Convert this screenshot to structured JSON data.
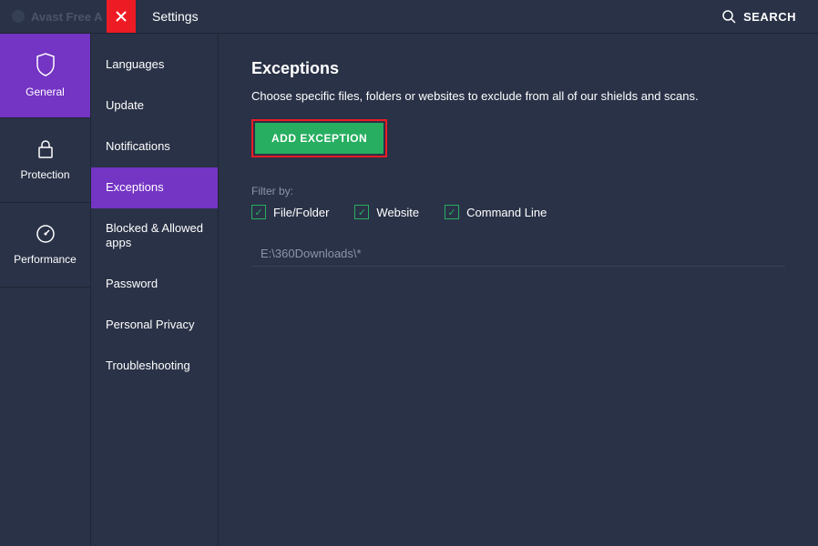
{
  "app_title": "Avast Free A",
  "header": {
    "settings_label": "Settings",
    "search_label": "SEARCH"
  },
  "sidebar_primary": [
    {
      "id": "general",
      "label": "General",
      "icon": "shield",
      "active": true
    },
    {
      "id": "protection",
      "label": "Protection",
      "icon": "lock",
      "active": false
    },
    {
      "id": "performance",
      "label": "Performance",
      "icon": "gauge",
      "active": false
    }
  ],
  "sidebar_secondary": [
    {
      "id": "languages",
      "label": "Languages",
      "active": false
    },
    {
      "id": "update",
      "label": "Update",
      "active": false
    },
    {
      "id": "notifications",
      "label": "Notifications",
      "active": false
    },
    {
      "id": "exceptions",
      "label": "Exceptions",
      "active": true
    },
    {
      "id": "blocked",
      "label": "Blocked & Allowed apps",
      "active": false
    },
    {
      "id": "password",
      "label": "Password",
      "active": false
    },
    {
      "id": "privacy",
      "label": "Personal Privacy",
      "active": false
    },
    {
      "id": "troubleshooting",
      "label": "Troubleshooting",
      "active": false
    }
  ],
  "content": {
    "title": "Exceptions",
    "description": "Choose specific files, folders or websites to exclude from all of our shields and scans.",
    "add_button": "ADD EXCEPTION",
    "filter_label": "Filter by:",
    "filters": [
      {
        "id": "file-folder",
        "label": "File/Folder",
        "checked": true
      },
      {
        "id": "website",
        "label": "Website",
        "checked": true
      },
      {
        "id": "command-line",
        "label": "Command Line",
        "checked": true
      }
    ],
    "exceptions_list": [
      "E:\\360Downloads\\*"
    ]
  }
}
